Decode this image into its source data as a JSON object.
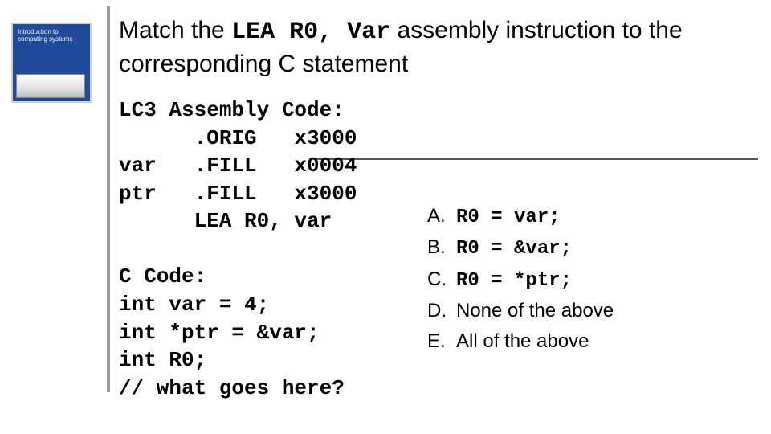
{
  "thumb": {
    "line1": "Introduction to",
    "line2": "computing systems"
  },
  "title": {
    "pre": "Match the ",
    "code": "LEA R0, Var",
    "post": " assembly instruction to the corresponding C statement"
  },
  "code": "LC3 Assembly Code:\n      .ORIG   x3000\nvar   .FILL   x0004\nptr   .FILL   x3000\n      LEA R0, var\n\nC Code:\nint var = 4;\nint *ptr = &var;\nint R0;\n// what goes here?",
  "options": [
    {
      "label": "A.",
      "text": "R0 = var;",
      "mono": true
    },
    {
      "label": "B.",
      "text": "R0 = &var;",
      "mono": true
    },
    {
      "label": "C.",
      "text": "R0 = *ptr;",
      "mono": true
    },
    {
      "label": "D.",
      "text": "None of the above",
      "mono": false
    },
    {
      "label": "E.",
      "text": "All of the above",
      "mono": false
    }
  ]
}
